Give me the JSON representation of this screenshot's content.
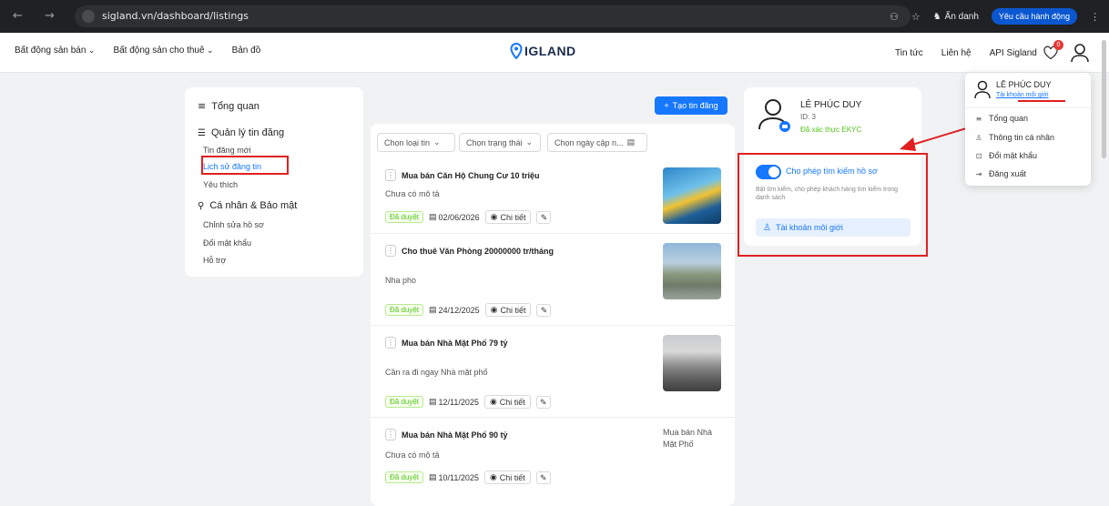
{
  "browser": {
    "nav_icons": "← → C",
    "url": "sigland.vn/dashboard/listings",
    "incognito_label": "Ẩn danh",
    "action_label": "Yêu cầu hành động"
  },
  "topnav": {
    "menu": [
      "Bất động sản bán",
      "Bất động sản cho thuê",
      "Bản đồ"
    ],
    "logo_text": "IGLAND",
    "right_links": [
      "Tin tức",
      "Liên hệ",
      "API Sigland"
    ],
    "favorites_count": "0"
  },
  "sidebar": {
    "overview": "Tổng quan",
    "manage_listings": "Quản lý tin đăng",
    "listing_items": [
      "Tin đăng mới",
      "Lịch sử đăng tin",
      "Yêu thích"
    ],
    "personal": "Cá nhân & Bảo mật",
    "personal_items": [
      "Chỉnh sửa hồ sơ",
      "Đổi mật khẩu",
      "Hỗ trợ"
    ]
  },
  "listings": {
    "create_button": "Tạo tin đăng",
    "filters": [
      "Chọn loại tin",
      "Chọn trạng thái",
      "Chọn ngày cập n..."
    ],
    "detail_label": "Chi tiết",
    "items": [
      {
        "title": "Mua bán Căn Hộ Chung Cư 10 triệu",
        "desc": "Chưa có mô tả",
        "status": "Đã duyệt",
        "date": "02/06/2026"
      },
      {
        "title": "Cho thuê Văn Phòng 20000000 tr/tháng",
        "desc": "Nha pho",
        "status": "Đã duyệt",
        "date": "24/12/2025"
      },
      {
        "title": "Mua bán Nhà Mặt Phố 79 tỷ",
        "desc": "Cần ra đi ngay Nhà mặt phố",
        "status": "Đã duyệt",
        "date": "12/11/2025"
      },
      {
        "title": "Mua bán Nhà Mặt Phố 90 tỷ",
        "desc": "Chưa có mô tả",
        "status": "Đã duyệt",
        "date": "10/11/2025",
        "image_alt": "Mua bán Nhà Mặt Phố"
      }
    ]
  },
  "profile": {
    "name": "LÊ PHÚC DUY",
    "id": "ID: 3",
    "verified": "Đã xác thực EKYC",
    "toggle_label": "Cho phép tìm kiếm hồ sơ",
    "toggle_help": "Bật tìm kiếm, cho phép khách hàng tìm kiếm trong danh sách",
    "broker_label": "Tài khoản môi giới"
  },
  "dropdown": {
    "name": "LÊ PHÚC DUY",
    "role": "Tài khoản môi giới",
    "items": [
      "Tổng quan",
      "Thông tin cá nhân",
      "Đổi mật khẩu",
      "Đăng xuất"
    ]
  },
  "colors": {
    "primary": "#1677ff",
    "highlight": "#e02020",
    "success": "#52c41a"
  }
}
